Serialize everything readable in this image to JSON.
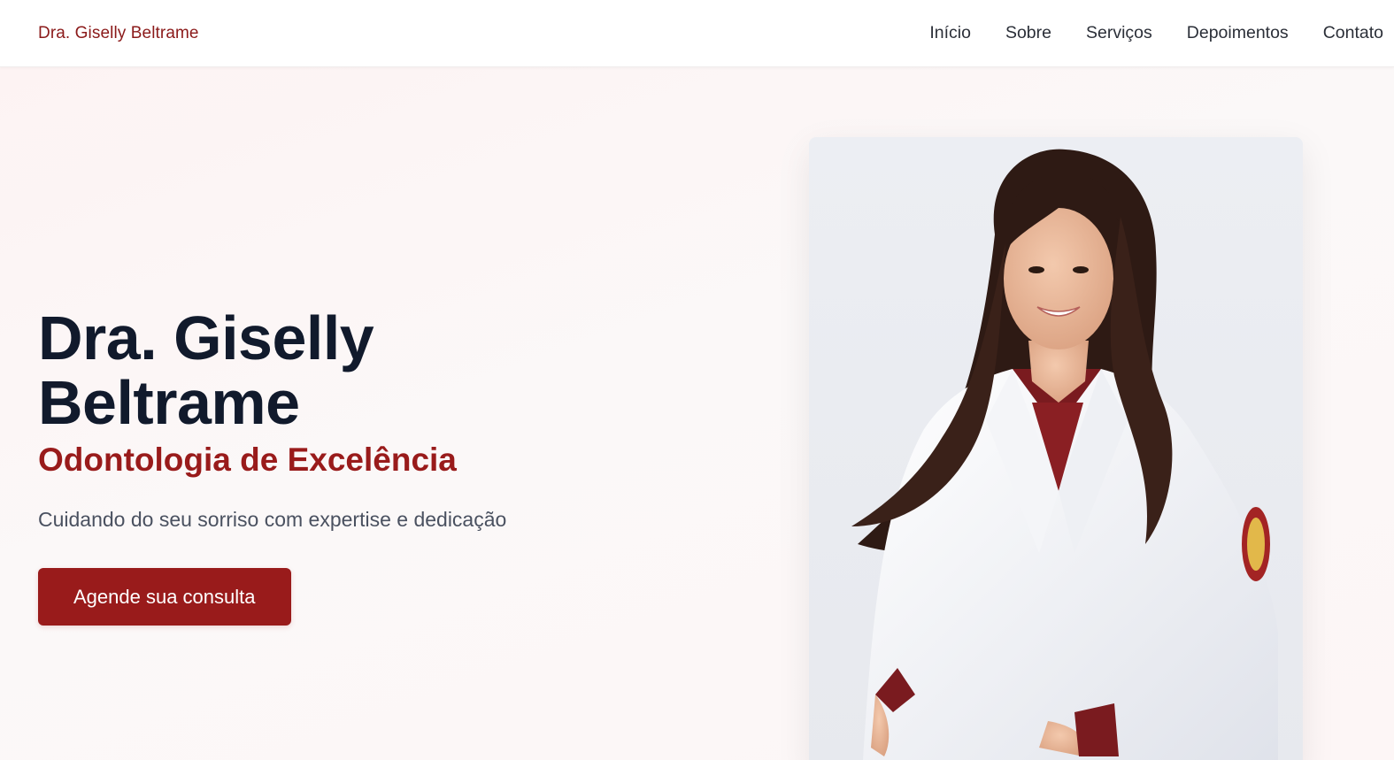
{
  "navbar": {
    "brand": "Dra. Giselly Beltrame",
    "links": [
      {
        "label": "Início"
      },
      {
        "label": "Sobre"
      },
      {
        "label": "Serviços"
      },
      {
        "label": "Depoimentos"
      },
      {
        "label": "Contato"
      }
    ]
  },
  "hero": {
    "title_line1": "Dra. Giselly",
    "title_line2": "Beltrame",
    "subtitle": "Odontologia de Excelência",
    "description": "Cuidando do seu sorriso com expertise e dedicação",
    "cta_label": "Agende sua consulta",
    "photo_icon": "portrait-photo"
  },
  "colors": {
    "brand": "#991b1b",
    "title": "#111a2c",
    "background": "#fdf4f4"
  }
}
